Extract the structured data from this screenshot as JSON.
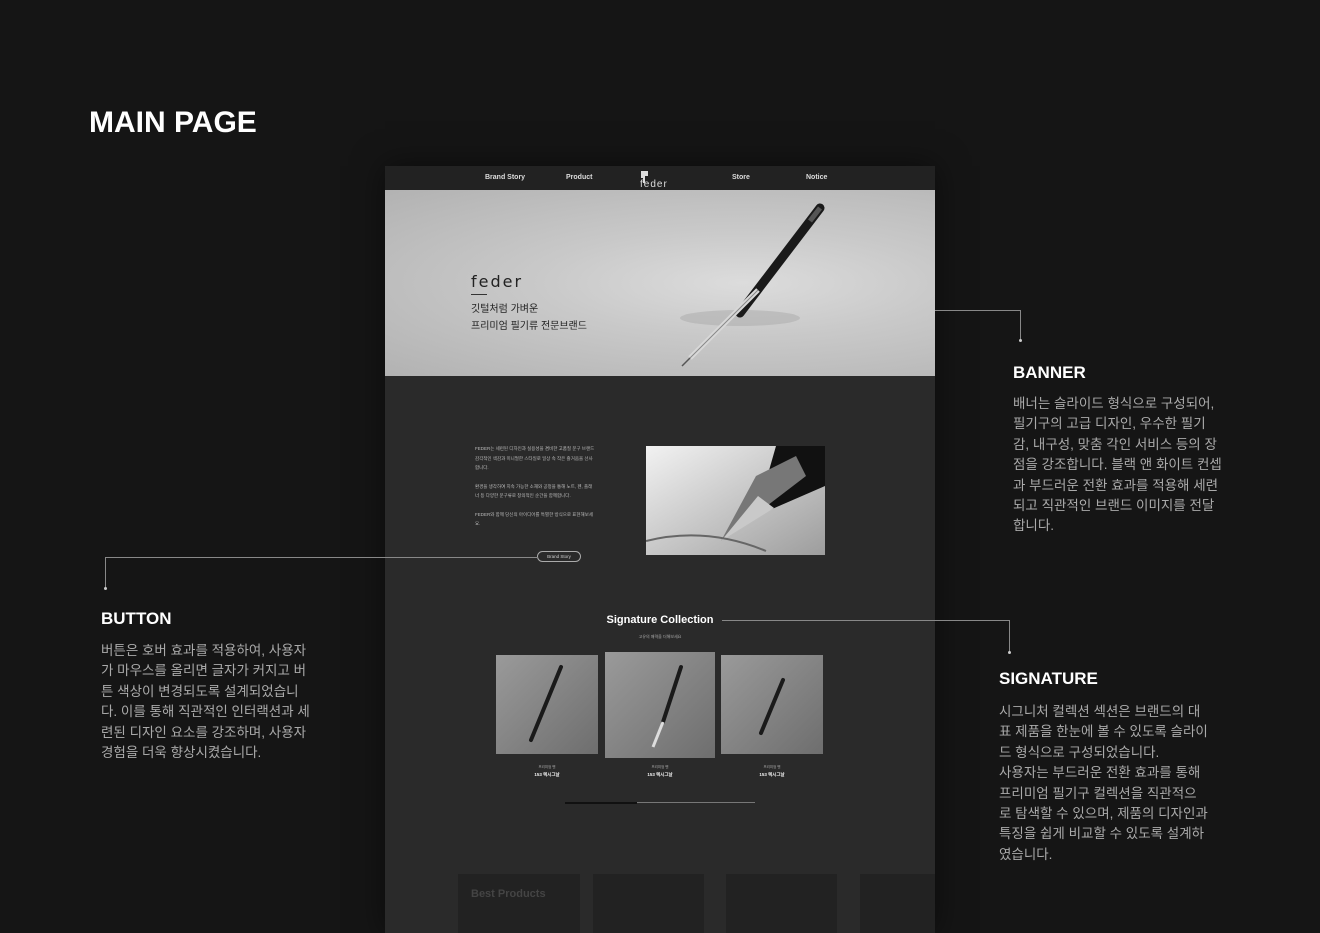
{
  "page_title": "MAIN PAGE",
  "nav": {
    "items": [
      "Brand Story",
      "Product",
      "Store",
      "Notice"
    ],
    "logo": "feder"
  },
  "banner": {
    "logo": "feder",
    "line1": "깃털처럼 가벼운",
    "line2": "프리미엄 필기류 전문브랜드"
  },
  "intro": {
    "p1": "FEDER는 세련된 디자인과 실용성을 겸비한 고품질 문구 브랜드 감각적인 색감과 미니멀한 스타일로 일상 속 작은 즐거움을 선사합니다.",
    "p2": "환경을 생각하여 지속 가능한 소재와 공정을 통해 노트, 펜, 플래너 등 다양한 문구류로 창의적인 순간을 함께합니다.",
    "p3": "FEDER와 함께 당신의 아이디어를 특별한 방식으로 표현해보세요.",
    "button": "Brand Story"
  },
  "signature": {
    "title": "Signature Collection",
    "subtitle": "고유의 매력을 더해보세요",
    "cards": [
      {
        "label": "프리미엄 펜",
        "name": "153 렉시그날"
      },
      {
        "label": "프리미엄 펜",
        "name": "153 렉시그날"
      },
      {
        "label": "프리미엄 펜",
        "name": "153 렉시그날"
      }
    ],
    "slider_progress": 0.38
  },
  "best": {
    "title": "Best Products"
  },
  "annotations": {
    "banner": {
      "title": "BANNER",
      "lines": [
        "배너는 슬라이드 형식으로 구성되어,",
        "필기구의 고급 디자인, 우수한 필기",
        "감, 내구성, 맞춤 각인 서비스 등의 장",
        "점을 강조합니다. 블랙 앤 화이트 컨셉",
        "과 부드러운 전환 효과를 적용해 세련",
        "되고 직관적인 브랜드 이미지를 전달",
        "합니다."
      ]
    },
    "button": {
      "title": "BUTTON",
      "lines": [
        "버튼은 호버 효과를 적용하여, 사용자",
        "가 마우스를 올리면 글자가 커지고 버",
        "튼 색상이 변경되도록 설계되었습니",
        "다. 이를 통해 직관적인 인터랙션과 세",
        "련된 디자인 요소를 강조하며, 사용자",
        "경험을 더욱 향상시켰습니다."
      ]
    },
    "signature": {
      "title": "SIGNATURE",
      "lines": [
        "시그니처 컬렉션 섹션은 브랜드의 대",
        "표 제품을 한눈에 볼 수 있도록 슬라이",
        "드 형식으로 구성되었습니다.",
        "사용자는 부드러운 전환 효과를 통해",
        "프리미엄 필기구 컬렉션을 직관적으",
        "로 탐색할 수 있으며, 제품의 디자인과",
        "특징을 쉽게 비교할 수 있도록 설계하",
        "였습니다."
      ]
    }
  }
}
